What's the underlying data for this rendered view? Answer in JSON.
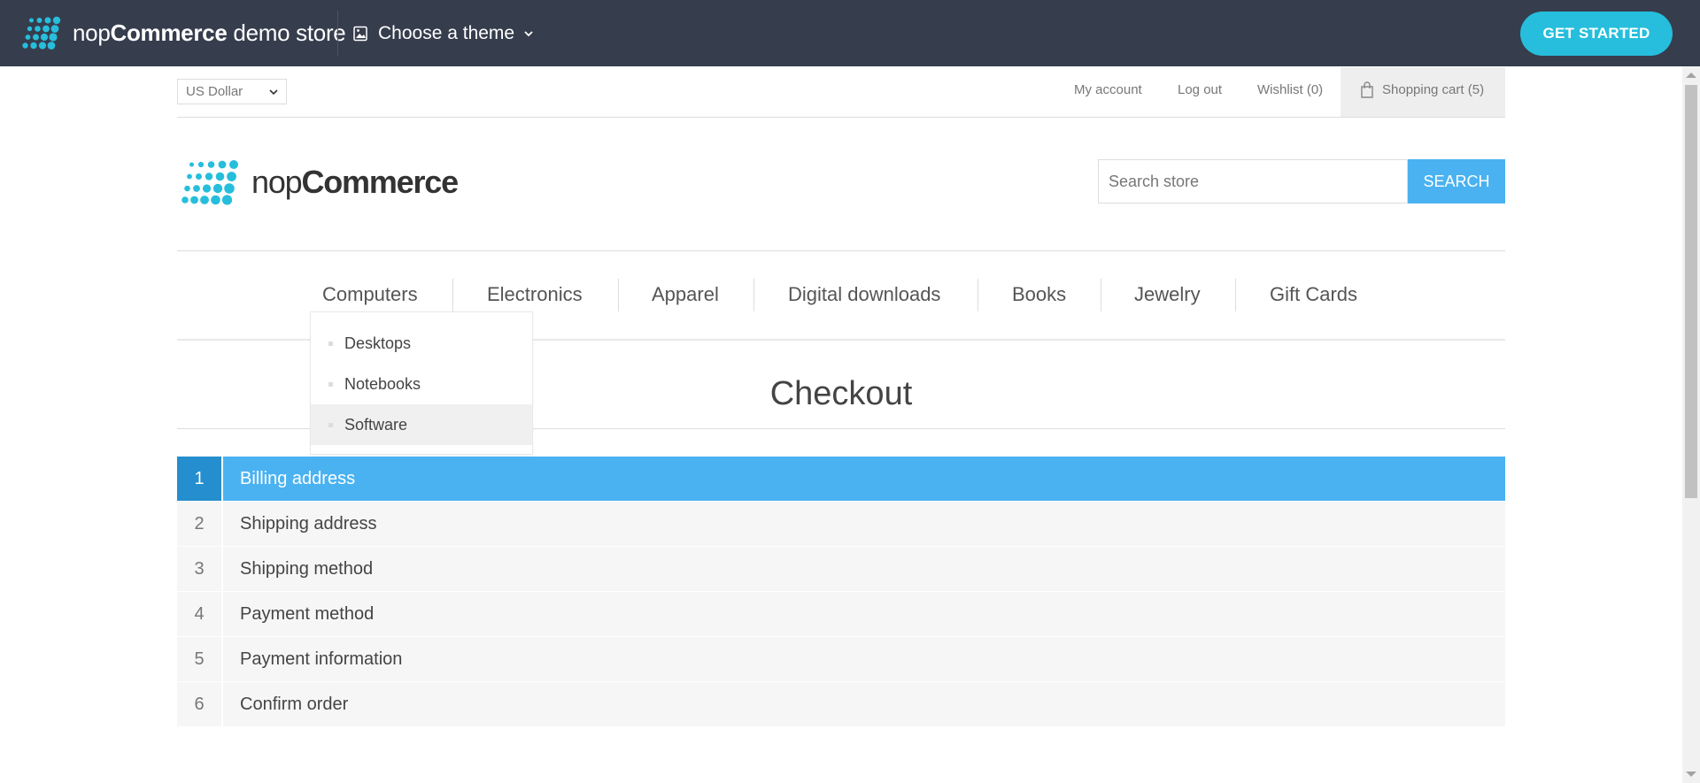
{
  "topbar": {
    "brand_prefix": "nop",
    "brand_bold": "Commerce",
    "brand_suffix": " demo store",
    "theme_label": "Choose a theme",
    "get_started": "GET STARTED"
  },
  "header": {
    "currency": "US Dollar",
    "links": {
      "my_account": "My account",
      "log_out": "Log out",
      "wishlist": "Wishlist (0)",
      "cart": "Shopping cart (5)"
    }
  },
  "logo": {
    "light": "nop",
    "bold": "Commerce"
  },
  "search": {
    "placeholder": "Search store",
    "button": "SEARCH"
  },
  "nav": {
    "items": [
      "Computers",
      "Electronics",
      "Apparel",
      "Digital downloads",
      "Books",
      "Jewelry",
      "Gift Cards"
    ]
  },
  "dropdown": {
    "items": [
      "Desktops",
      "Notebooks",
      "Software"
    ],
    "hovered": "Software"
  },
  "page": {
    "title": "Checkout"
  },
  "checkout": {
    "steps": [
      {
        "num": "1",
        "label": "Billing address",
        "active": true
      },
      {
        "num": "2",
        "label": "Shipping address"
      },
      {
        "num": "3",
        "label": "Shipping method"
      },
      {
        "num": "4",
        "label": "Payment method"
      },
      {
        "num": "5",
        "label": "Payment information"
      },
      {
        "num": "6",
        "label": "Confirm order"
      }
    ]
  },
  "colors": {
    "topbar_bg": "#363d4d",
    "accent_cyan": "#26bedc",
    "accent_blue": "#4ab2f1",
    "active_num_blue": "#248ece",
    "step_bg": "#f6f6f6"
  },
  "icons": [
    "nopcommerce-dots-logo",
    "image-icon",
    "chevron-down-icon",
    "shopping-bag-icon"
  ]
}
